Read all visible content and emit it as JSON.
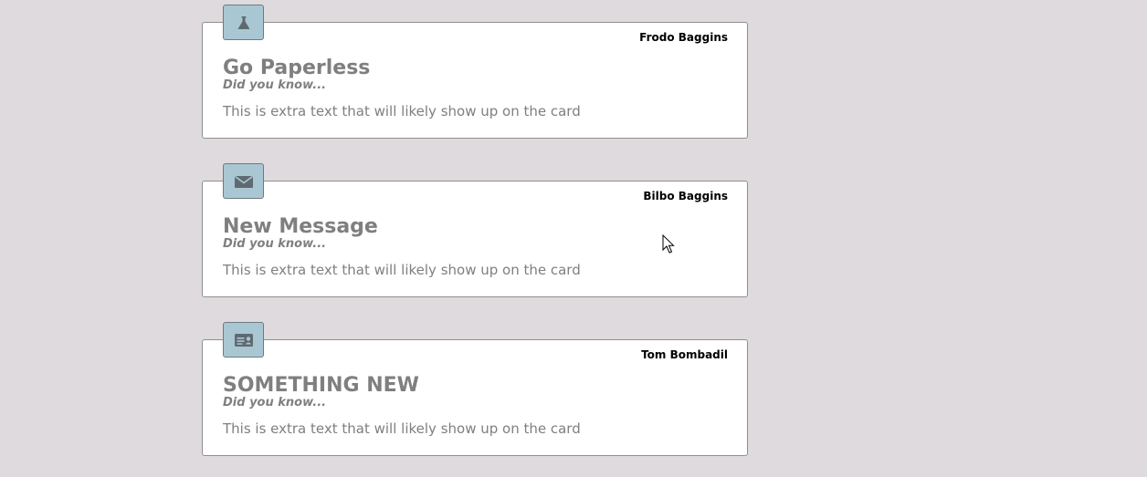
{
  "cards": [
    {
      "icon": "flask-icon",
      "author": "Frodo Baggins",
      "title": "Go Paperless",
      "subtitle": "Did you know...",
      "body": "This is extra text that will likely show up on the card"
    },
    {
      "icon": "envelope-icon",
      "author": "Bilbo Baggins",
      "title": "New Message",
      "subtitle": "Did you know...",
      "body": "This is extra text that will likely show up on the card"
    },
    {
      "icon": "id-card-icon",
      "author": "Tom Bombadil",
      "title": "SOMETHING NEW",
      "subtitle": "Did you know...",
      "body": "This is extra text that will likely show up on the card"
    }
  ],
  "colors": {
    "background": "#dfdadd",
    "card_background": "#ffffff",
    "icon_badge": "#a9c7d3",
    "icon_glyph": "#5f6a70",
    "text_muted": "#7f7f7f",
    "author_text": "#000000"
  }
}
